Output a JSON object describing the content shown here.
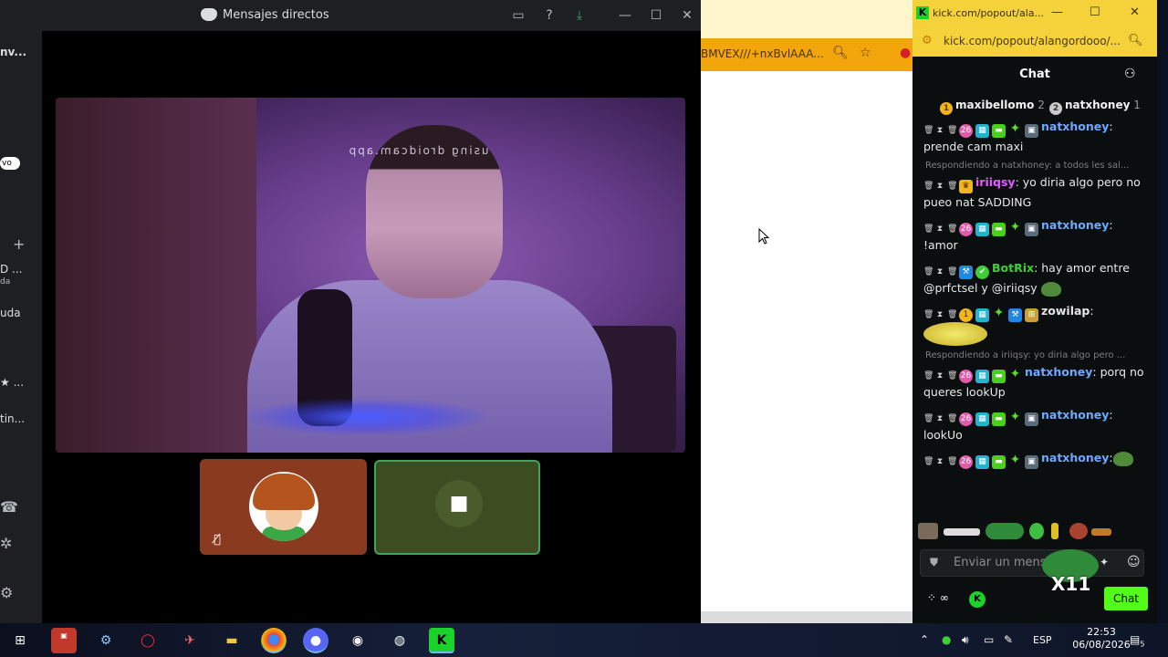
{
  "discord": {
    "window_title": "Mensajes directos",
    "sidebar": {
      "top_label": "nv...",
      "pill": "vo",
      "item1_line1": "D ...",
      "item1_line2": "da",
      "item2": "uda",
      "item3": "★ ...",
      "item4": "tin..."
    },
    "video": {
      "watermark": "using droidcam.app"
    }
  },
  "browser": {
    "address_fragment": "BMVEX///+nxBvlAAA...",
    "bg": "#ffffff"
  },
  "kick": {
    "window_title": "kick.com/popout/ala...",
    "url": "kick.com/popout/alangordooo/...",
    "chat_title": "Chat",
    "top_gifters": [
      {
        "rank": "1",
        "name": "maxibellomo",
        "count": "2"
      },
      {
        "rank": "2",
        "name": "natxhoney",
        "count": "1"
      }
    ],
    "messages": [
      {
        "reply": "",
        "user": "natxhoney",
        "user_color": "#6fa8ff",
        "text": ": prende cam maxi"
      },
      {
        "reply": "Respondiendo a natxhoney: a todos les sal...",
        "user": "iriiqsy",
        "user_color": "#e45aff",
        "text": ": yo diria algo pero no pueo nat SADDING"
      },
      {
        "reply": "",
        "user": "natxhoney",
        "user_color": "#6fa8ff",
        "text": ": !amor"
      },
      {
        "reply": "",
        "user": "BotRix",
        "user_color": "#3ecf35",
        "text": ": hay amor entre @prfctsel y @iriiqsy"
      },
      {
        "reply": "",
        "user": "zowilap",
        "user_color": "#e6e6e6",
        "text": ":"
      },
      {
        "reply": "Respondiendo a iriiqsy: yo diria algo pero ...",
        "user": "natxhoney",
        "user_color": "#6fa8ff",
        "text": ": porq no queres lookUp"
      },
      {
        "reply": "",
        "user": "natxhoney",
        "user_color": "#6fa8ff",
        "text": ": lookUo"
      },
      {
        "reply": "",
        "user": "natxhoney",
        "user_color": "#6fa8ff",
        "text": ":"
      }
    ],
    "input_placeholder": "Enviar un mensaje",
    "overlay_text": "X11",
    "send_label": "Chat",
    "accent": "#53fc18"
  },
  "taskbar": {
    "time": "22:53",
    "date": "06/08/2026",
    "lang": "ESP",
    "notifications": "5"
  }
}
